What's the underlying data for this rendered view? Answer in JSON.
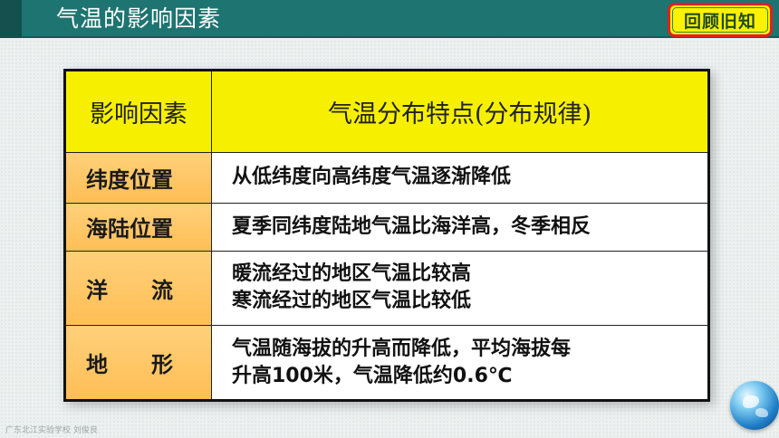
{
  "header": {
    "title": "气温的影响因素",
    "badge": "回顾旧知"
  },
  "table": {
    "headers": [
      "影响因素",
      "气温分布特点(分布规律)"
    ],
    "rows": [
      {
        "factor": "纬度位置",
        "lines": [
          "从低纬度向高纬度气温逐渐降低"
        ]
      },
      {
        "factor": "海陆位置",
        "lines": [
          "夏季同纬度陆地气温比海洋高，冬季相反"
        ]
      },
      {
        "factor": "洋　　流",
        "lines": [
          "暖流经过的地区气温比较高",
          "寒流经过的地区气温比较低"
        ]
      },
      {
        "factor": "地　　形",
        "lines": [
          "气温随海拔的升高而降低，平均海拔每",
          "升高100米，气温降低约0.6℃"
        ]
      }
    ]
  },
  "footer": {
    "watermark": "广东北江实验学校 刘俊良"
  },
  "icons": {
    "globe": "globe-icon"
  },
  "colors": {
    "header": "#1e7470",
    "badge_fill": "#fff200",
    "badge_border": "#e02020",
    "table_head": "#f6f000",
    "factor_fill": "#ffc760"
  }
}
